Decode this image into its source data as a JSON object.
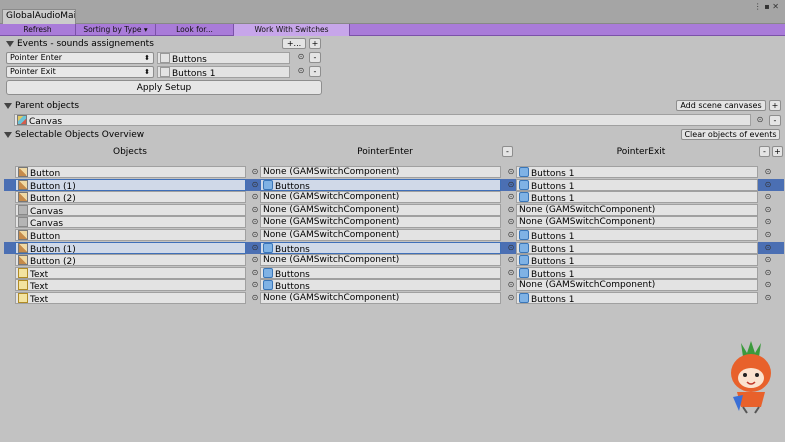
{
  "window": {
    "tab_title": "GlobalAudioMai",
    "menu_glyph": "⋮ ▪ ✕"
  },
  "toolbar": {
    "refresh": "Refresh",
    "sorting": "Sorting by Type ▾",
    "look": "Look for...",
    "switches": "Work With Switches"
  },
  "events": {
    "header": "Events - sounds assignements",
    "add_btn": "+...",
    "plus_btn": "+",
    "rows": [
      {
        "type": "Pointer Enter",
        "target": "Buttons"
      },
      {
        "type": "Pointer Exit",
        "target": "Buttons 1"
      }
    ],
    "apply": "Apply Setup"
  },
  "parent": {
    "header": "Parent objects",
    "add_btn": "Add scene canvases",
    "plus_btn": "+",
    "value": "Canvas"
  },
  "overview": {
    "header": "Selectable Objects Overview",
    "clear_btn": "Clear objects of events",
    "columns": {
      "objects": "Objects",
      "enter": "PointerEnter",
      "exit": "PointerExit"
    },
    "rows": [
      {
        "object": "Button",
        "oicon": "button-object-icon",
        "enter": "None (GAMSwitchComponent)",
        "exit": "Buttons 1",
        "highlight": false
      },
      {
        "object": "Button (1)",
        "oicon": "button-object-icon",
        "enter": "Buttons",
        "exit": "Buttons 1",
        "highlight": true
      },
      {
        "object": "Button (2)",
        "oicon": "button-object-icon",
        "enter": "None (GAMSwitchComponent)",
        "exit": "Buttons 1",
        "highlight": false
      },
      {
        "object": "Canvas",
        "oicon": "canvas-object-icon",
        "enter": "None (GAMSwitchComponent)",
        "exit": "None (GAMSwitchComponent)",
        "highlight": false
      },
      {
        "object": "Canvas",
        "oicon": "canvas-object-icon",
        "enter": "None (GAMSwitchComponent)",
        "exit": "None (GAMSwitchComponent)",
        "highlight": false
      },
      {
        "object": "Button",
        "oicon": "button-object-icon",
        "enter": "None (GAMSwitchComponent)",
        "exit": "Buttons 1",
        "highlight": false
      },
      {
        "object": "Button (1)",
        "oicon": "button-object-icon",
        "enter": "Buttons",
        "exit": "Buttons 1",
        "highlight": true
      },
      {
        "object": "Button (2)",
        "oicon": "button-object-icon",
        "enter": "None (GAMSwitchComponent)",
        "exit": "Buttons 1",
        "highlight": false
      },
      {
        "object": "Text",
        "oicon": "text-object-icon",
        "enter": "Buttons",
        "exit": "Buttons 1",
        "highlight": false
      },
      {
        "object": "Text",
        "oicon": "text-object-icon",
        "enter": "Buttons",
        "exit": "None (GAMSwitchComponent)",
        "highlight": false
      },
      {
        "object": "Text",
        "oicon": "text-object-icon",
        "enter": "None (GAMSwitchComponent)",
        "exit": "Buttons 1",
        "highlight": false
      }
    ]
  },
  "colors": {
    "toolbar": "#a97bd9",
    "highlight": "#4b6fb3",
    "background": "#c2c2c2"
  }
}
